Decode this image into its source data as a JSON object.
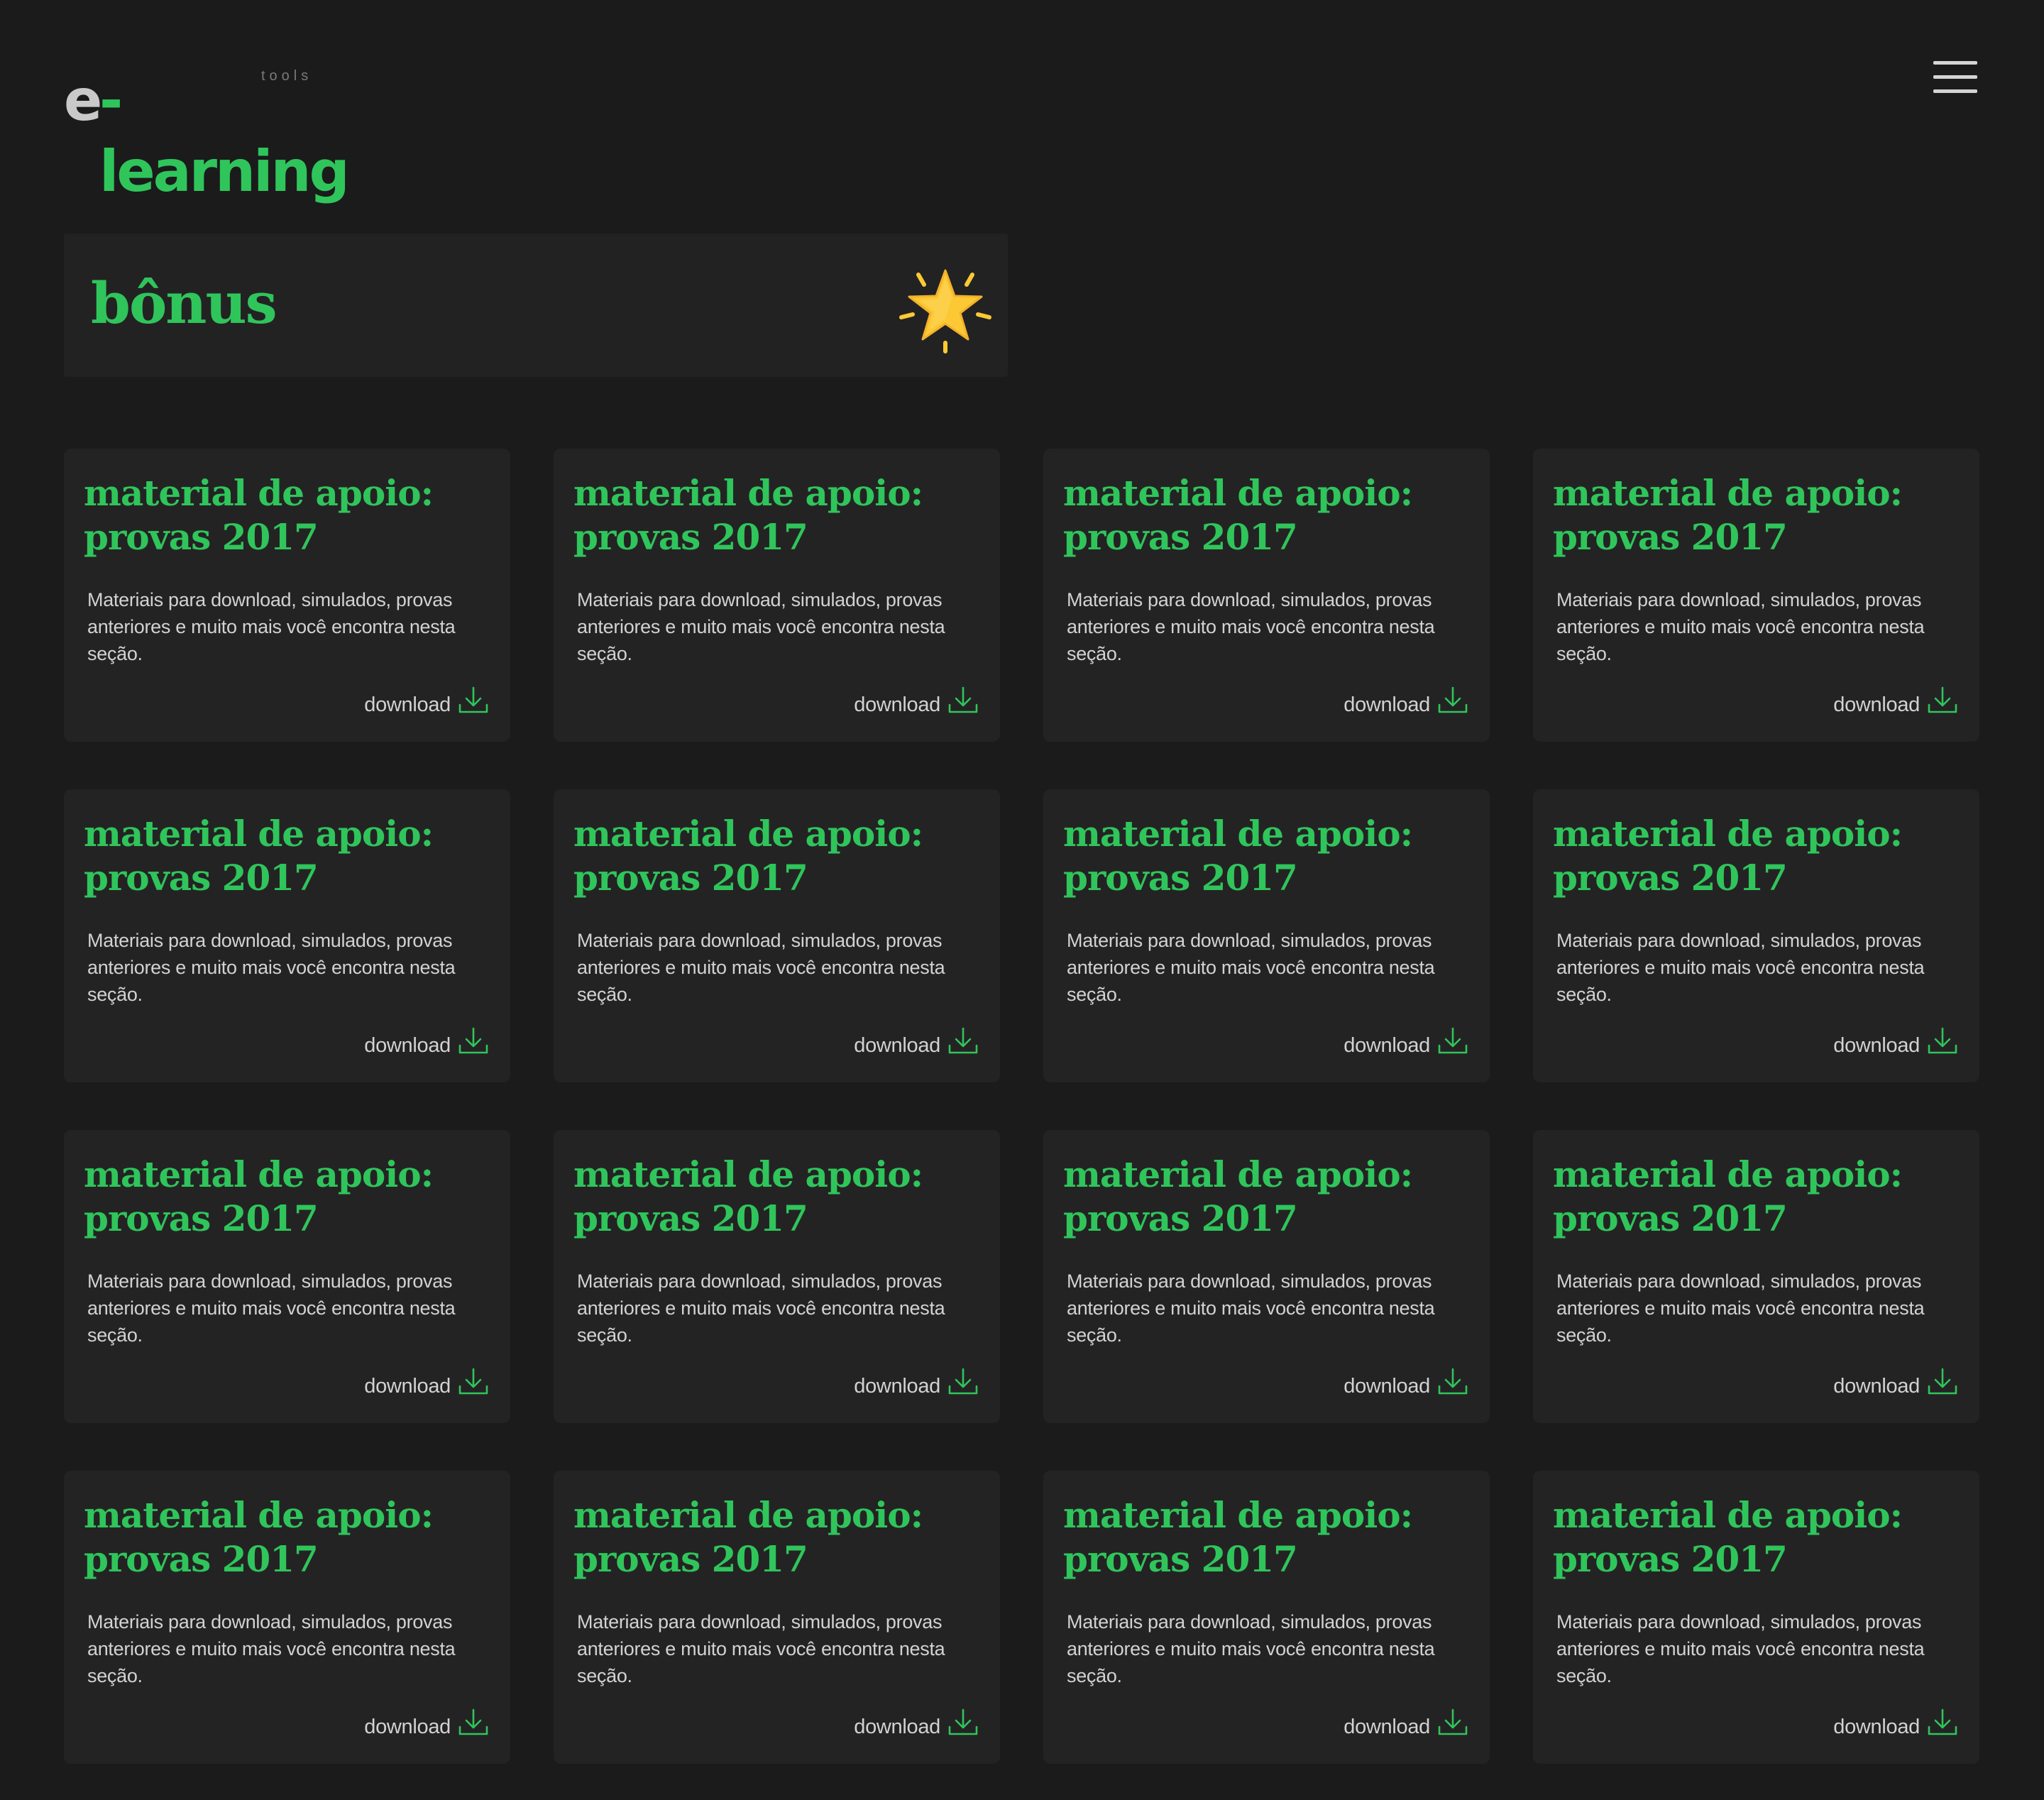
{
  "header": {
    "logo_e": "e",
    "logo_learning": "-learning",
    "logo_tools": "tools",
    "menu_icon": "hamburger-menu-icon"
  },
  "section": {
    "title": "bônus",
    "icon": "star-icon"
  },
  "colors": {
    "background": "#1b1b1c",
    "card": "#242324",
    "accent": "#2fc55b",
    "text": "#d2d2d2",
    "star": "#fcc934"
  },
  "cards": [
    {
      "title": "material de apoio: provas 2017",
      "description": "Materiais para download, simulados, provas anteriores e muito mais você encontra nesta seção.",
      "action": "download",
      "icon": "download-icon"
    },
    {
      "title": "material de apoio: provas 2017",
      "description": "Materiais para download, simulados, provas anteriores e muito mais você encontra nesta seção.",
      "action": "download",
      "icon": "download-icon"
    },
    {
      "title": "material de apoio: provas 2017",
      "description": "Materiais para download, simulados, provas anteriores e muito mais você encontra nesta seção.",
      "action": "download",
      "icon": "download-icon"
    },
    {
      "title": "material de apoio: provas 2017",
      "description": "Materiais para download, simulados, provas anteriores e muito mais você encontra nesta seção.",
      "action": "download",
      "icon": "download-icon"
    },
    {
      "title": "material de apoio: provas 2017",
      "description": "Materiais para download, simulados, provas anteriores e muito mais você encontra nesta seção.",
      "action": "download",
      "icon": "download-icon"
    },
    {
      "title": "material de apoio: provas 2017",
      "description": "Materiais para download, simulados, provas anteriores e muito mais você encontra nesta seção.",
      "action": "download",
      "icon": "download-icon"
    },
    {
      "title": "material de apoio: provas 2017",
      "description": "Materiais para download, simulados, provas anteriores e muito mais você encontra nesta seção.",
      "action": "download",
      "icon": "download-icon"
    },
    {
      "title": "material de apoio: provas 2017",
      "description": "Materiais para download, simulados, provas anteriores e muito mais você encontra nesta seção.",
      "action": "download",
      "icon": "download-icon"
    },
    {
      "title": "material de apoio: provas 2017",
      "description": "Materiais para download, simulados, provas anteriores e muito mais você encontra nesta seção.",
      "action": "download",
      "icon": "download-icon"
    },
    {
      "title": "material de apoio: provas 2017",
      "description": "Materiais para download, simulados, provas anteriores e muito mais você encontra nesta seção.",
      "action": "download",
      "icon": "download-icon"
    },
    {
      "title": "material de apoio: provas 2017",
      "description": "Materiais para download, simulados, provas anteriores e muito mais você encontra nesta seção.",
      "action": "download",
      "icon": "download-icon"
    },
    {
      "title": "material de apoio: provas 2017",
      "description": "Materiais para download, simulados, provas anteriores e muito mais você encontra nesta seção.",
      "action": "download",
      "icon": "download-icon"
    },
    {
      "title": "material de apoio: provas 2017",
      "description": "Materiais para download, simulados, provas anteriores e muito mais você encontra nesta seção.",
      "action": "download",
      "icon": "download-icon"
    },
    {
      "title": "material de apoio: provas 2017",
      "description": "Materiais para download, simulados, provas anteriores e muito mais você encontra nesta seção.",
      "action": "download",
      "icon": "download-icon"
    },
    {
      "title": "material de apoio: provas 2017",
      "description": "Materiais para download, simulados, provas anteriores e muito mais você encontra nesta seção.",
      "action": "download",
      "icon": "download-icon"
    },
    {
      "title": "material de apoio: provas 2017",
      "description": "Materiais para download, simulados, provas anteriores e muito mais você encontra nesta seção.",
      "action": "download",
      "icon": "download-icon"
    }
  ]
}
